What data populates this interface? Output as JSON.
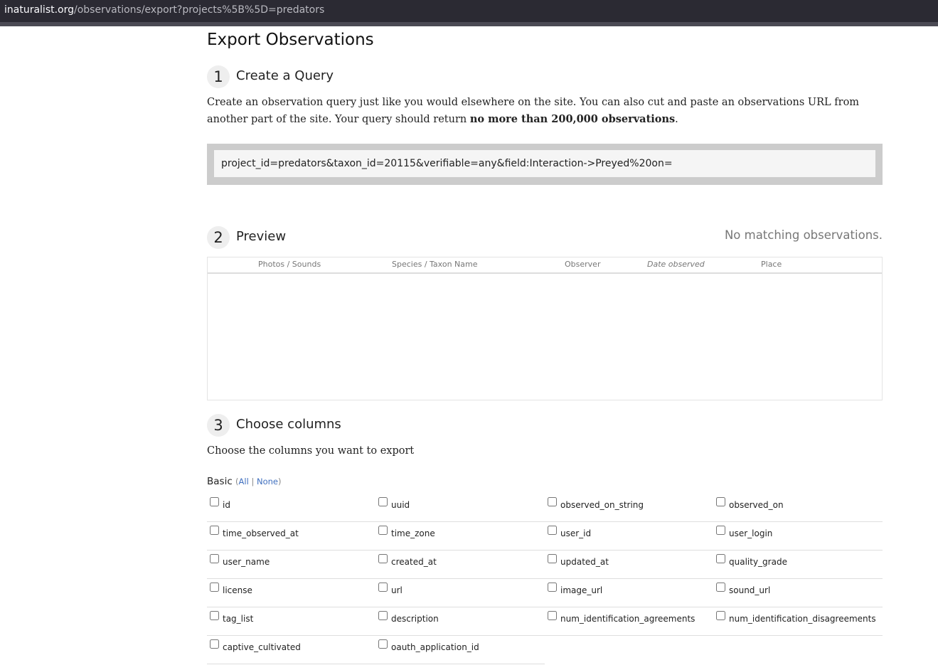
{
  "browser": {
    "url_host": "inaturalist.org",
    "url_path": "/observations/export?projects%5B%5D=predators"
  },
  "page": {
    "title": "Export Observations"
  },
  "step1": {
    "number": "1",
    "title": "Create a Query",
    "intro_text": "Create an observation query just like you would elsewhere on the site. You can also cut and paste an observations URL from another part of the site. Your query should return ",
    "intro_bold": "no more than 200,000 observations",
    "intro_end": ".",
    "query_value": "project_id=predators&taxon_id=20115&verifiable=any&field:Interaction->Preyed%20on="
  },
  "step2": {
    "number": "2",
    "title": "Preview",
    "status": "No matching observations.",
    "columns": [
      "Photos / Sounds",
      "Species / Taxon Name",
      "Observer",
      "Date observed",
      "Place"
    ]
  },
  "step3": {
    "number": "3",
    "title": "Choose columns",
    "description": "Choose the columns you want to export",
    "group_label": "Basic",
    "all_label": "All",
    "none_label": "None",
    "columns": [
      "id",
      "uuid",
      "observed_on_string",
      "observed_on",
      "time_observed_at",
      "time_zone",
      "user_id",
      "user_login",
      "user_name",
      "created_at",
      "updated_at",
      "quality_grade",
      "license",
      "url",
      "image_url",
      "sound_url",
      "tag_list",
      "description",
      "num_identification_agreements",
      "num_identification_disagreements",
      "captive_cultivated",
      "oauth_application_id"
    ]
  }
}
